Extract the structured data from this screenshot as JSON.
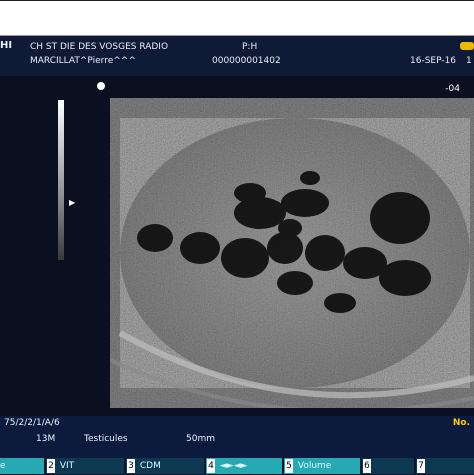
{
  "header": {
    "logo_fragment": "HI",
    "institution": "CH ST DIE DES VOSGES RADIO",
    "patient_name": "MARCILLAT^Pierre^^^",
    "ph_label": "P:H",
    "patient_id": "000000001402",
    "date": "16-SEP-16",
    "time_fragment": "1"
  },
  "depth_marker": "-04",
  "bottom": {
    "settings": "75/2/2/1/A/6",
    "preset": "13M",
    "organ": "Testicules",
    "depth": "50mm",
    "no_label": "No."
  },
  "softkeys": [
    {
      "num": "",
      "label": "e"
    },
    {
      "num": "2",
      "label": "VIT"
    },
    {
      "num": "3",
      "label": "CDM"
    },
    {
      "num": "4",
      "label": "◄►◄►"
    },
    {
      "num": "5",
      "label": "Volume"
    },
    {
      "num": "6",
      "label": ""
    },
    {
      "num": "7",
      "label": ""
    }
  ],
  "colors": {
    "screen_bg": "#0b1020",
    "header_bg": "#0f1a36",
    "softkey_active": "#26a9b3",
    "logo_yellow": "#f0b800"
  }
}
